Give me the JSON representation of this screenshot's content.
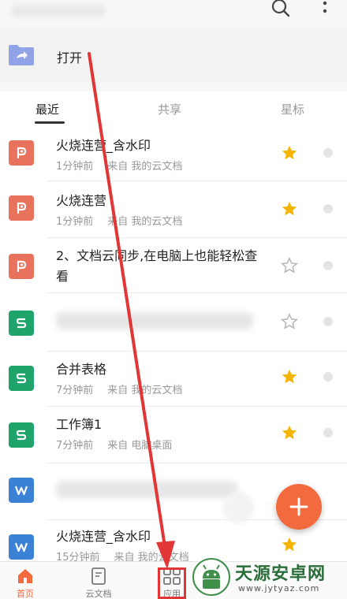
{
  "open_row": {
    "label": "打开"
  },
  "tabs": [
    {
      "label": "最近",
      "active": true
    },
    {
      "label": "共享",
      "active": false
    },
    {
      "label": "星标",
      "active": false
    }
  ],
  "files": [
    {
      "type": "ppt",
      "title": "火烧连营_含水印",
      "time": "1分钟前",
      "source": "来自 我的云文档",
      "starred": true
    },
    {
      "type": "ppt",
      "title": "火烧连营",
      "time": "1分钟前",
      "source": "来自 我的云文档",
      "starred": true
    },
    {
      "type": "ppt",
      "title": "2、文档云同步,在电脑上也能轻松查看",
      "time": "",
      "source": "",
      "starred": false
    },
    {
      "type": "xls",
      "title": "",
      "time": "",
      "source": "",
      "starred": false,
      "blurred": true
    },
    {
      "type": "xls",
      "title": "合并表格",
      "time": "7分钟前",
      "source": "来自 我的云文档",
      "starred": true
    },
    {
      "type": "xls",
      "title": "工作簿1",
      "time": "7分钟前",
      "source": "来自 电脑桌面",
      "starred": true
    },
    {
      "type": "doc",
      "title": "",
      "time": "",
      "source": "",
      "starred": false,
      "blurred": true
    },
    {
      "type": "doc",
      "title": "火烧连营_含水印",
      "time": "15分钟前",
      "source": "来自 我的云文档",
      "starred": true
    }
  ],
  "bottom_nav": [
    {
      "label": "首页",
      "icon": "home-icon",
      "active": true
    },
    {
      "label": "云文档",
      "icon": "document-icon",
      "active": false
    },
    {
      "label": "应用",
      "icon": "apps-grid-icon",
      "active": false
    }
  ],
  "watermark": {
    "title": "天源安卓网",
    "url": "www.jytyaz.com"
  },
  "colors": {
    "accent": "#f26a3e",
    "ppt": "#e8725c",
    "xls": "#1fa46b",
    "doc": "#3b82d6",
    "star": "#f5b400",
    "annotation": "#e23636"
  }
}
